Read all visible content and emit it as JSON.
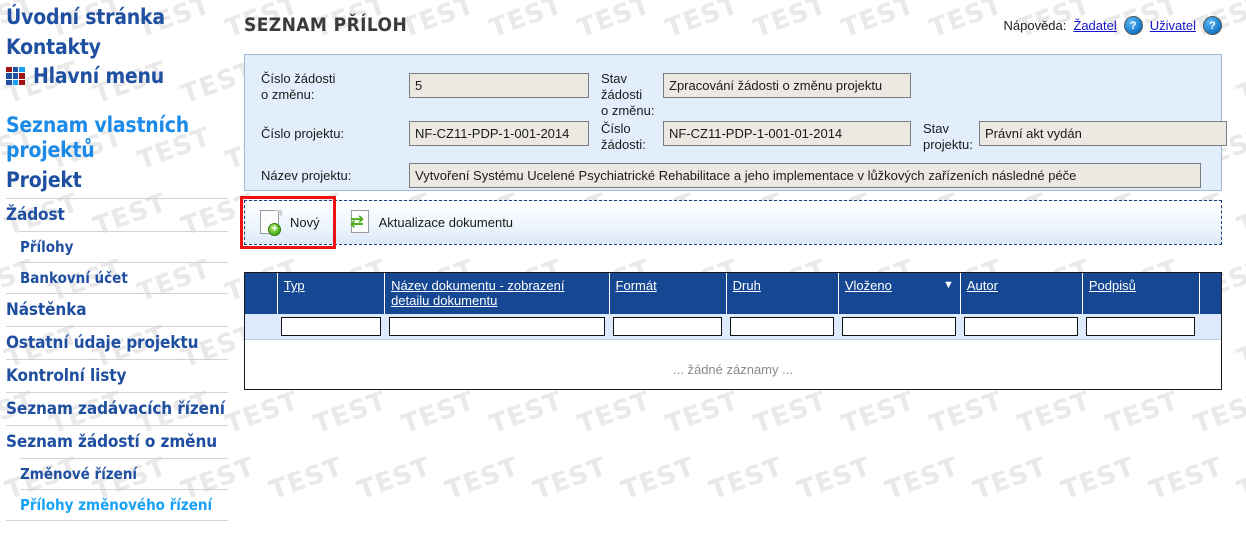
{
  "watermark": {
    "text": "TEST"
  },
  "sidebar": {
    "top_links": [
      {
        "label": "Úvodní stránka",
        "name": "sidebar-link-uvodni-stranka"
      },
      {
        "label": "Kontakty",
        "name": "sidebar-link-kontakty"
      }
    ],
    "main_menu_label": "Hlavní menu",
    "main_menu_icon": "grid-icon",
    "menu_icon_colors": [
      "#9e1316",
      "#1f4fa0",
      "#17a2f5",
      "#1f4fa0",
      "#1f4fa0",
      "#9e1316",
      "#1f4fa0",
      "#17a2f5",
      "#9e1316"
    ],
    "items": [
      {
        "label": "Seznam vlastních projektů",
        "level": 1,
        "active": true,
        "name": "sidebar-item-seznam-vlastnich-projektu"
      },
      {
        "label": "Projekt",
        "level": 1,
        "active": false,
        "name": "sidebar-item-projekt"
      },
      {
        "label": "Žádost",
        "level": 2,
        "active": false,
        "name": "sidebar-item-zadost"
      },
      {
        "label": "Přílohy",
        "level": 3,
        "active": false,
        "name": "sidebar-item-prilohy"
      },
      {
        "label": "Bankovní účet",
        "level": 3,
        "active": false,
        "name": "sidebar-item-bankovni-ucet"
      },
      {
        "label": "Nástěnka",
        "level": 2,
        "active": false,
        "name": "sidebar-item-nastenka"
      },
      {
        "label": "Ostatní údaje projektu",
        "level": 2,
        "active": false,
        "name": "sidebar-item-ostatni-udaje-projektu"
      },
      {
        "label": "Kontrolní listy",
        "level": 2,
        "active": false,
        "name": "sidebar-item-kontrolni-listy"
      },
      {
        "label": "Seznam zadávacích řízení",
        "level": 2,
        "active": false,
        "name": "sidebar-item-seznam-zadavacich-rizeni"
      },
      {
        "label": "Seznam žádostí o změnu",
        "level": 2,
        "active": false,
        "name": "sidebar-item-seznam-zadosti-o-zmenu"
      },
      {
        "label": "Změnové řízení",
        "level": 3,
        "active": false,
        "name": "sidebar-item-zmenove-rizeni"
      },
      {
        "label": "Přílohy změnového řízení",
        "level": 3,
        "active": true,
        "name": "sidebar-item-prilohy-zmenoveho-rizeni"
      }
    ]
  },
  "header": {
    "title": "SEZNAM PŘÍLOH",
    "help_label": "Nápověda:",
    "help_links": [
      {
        "label": "Žadatel",
        "name": "help-link-zadatel"
      },
      {
        "label": "Uživatel",
        "name": "help-link-uzivatel"
      }
    ],
    "help_icon": "question-mark-icon"
  },
  "form": {
    "fields": [
      {
        "label": "Číslo žádosti\no změnu:",
        "value": "5",
        "name": "field-cislo-zadosti-o-zmenu"
      },
      {
        "label": "Stav\nžádosti\no změnu:",
        "value": "Zpracování žádosti o změnu projektu",
        "name": "field-stav-zadosti-o-zmenu"
      },
      {
        "label": "Číslo projektu:",
        "value": "NF-CZ11-PDP-1-001-2014",
        "name": "field-cislo-projektu"
      },
      {
        "label": "Číslo\nžádosti:",
        "value": "NF-CZ11-PDP-1-001-01-2014",
        "name": "field-cislo-zadosti"
      },
      {
        "label": "Stav\nprojektu:",
        "value": "Právní akt vydán",
        "name": "field-stav-projektu"
      },
      {
        "label": "Název projektu:",
        "value": "Vytvoření Systému Ucelené Psychiatrické Rehabilitace a jeho implementace v lůžkových zařízeních následné péče",
        "name": "field-nazev-projektu"
      }
    ],
    "labels": {
      "cislo_zadosti_o_zmenu_l1": "Číslo žádosti",
      "cislo_zadosti_o_zmenu_l2": "o změnu:",
      "stav_zadosti_l1": "Stav",
      "stav_zadosti_l2": "žádosti",
      "stav_zadosti_l3": "o změnu:",
      "cislo_projektu": "Číslo projektu:",
      "cislo_zadosti_l1": "Číslo",
      "cislo_zadosti_l2": "žádosti:",
      "stav_projektu_l1": "Stav",
      "stav_projektu_l2": "projektu:",
      "nazev_projektu": "Název projektu:"
    },
    "values": {
      "cislo_zadosti_o_zmenu": "5",
      "stav_zadosti_o_zmenu": "Zpracování žádosti o změnu projektu",
      "cislo_projektu": "NF-CZ11-PDP-1-001-2014",
      "cislo_zadosti": "NF-CZ11-PDP-1-001-01-2014",
      "stav_projektu": "Právní akt vydán",
      "nazev_projektu": "Vytvoření Systému Ucelené Psychiatrické Rehabilitace a jeho implementace v lůžkových zařízeních následné péče"
    }
  },
  "toolbar": {
    "new_label": "Nový",
    "new_icon": "new-document-icon",
    "update_label": "Aktualizace dokumentu",
    "update_icon": "refresh-document-icon",
    "highlight_color": "#ee1111",
    "plus_glyph": "+",
    "refresh_glyph": "⇄"
  },
  "table": {
    "columns": [
      {
        "label": "",
        "name": "col-select",
        "width": "3.3%",
        "sorted": false
      },
      {
        "label": "Typ",
        "name": "col-typ",
        "width": "11.0%",
        "sorted": false
      },
      {
        "label": "Název dokumentu - zobrazení detailu dokumentu",
        "name": "col-nazev-dokumentu",
        "width": "23.0%",
        "sorted": false
      },
      {
        "label": "Formát",
        "name": "col-format",
        "width": "12.0%",
        "sorted": false
      },
      {
        "label": "Druh",
        "name": "col-druh",
        "width": "11.5%",
        "sorted": false
      },
      {
        "label": "Vloženo",
        "name": "col-vlozeno",
        "width": "12.5%",
        "sorted": true
      },
      {
        "label": "Autor",
        "name": "col-autor",
        "width": "12.5%",
        "sorted": false
      },
      {
        "label": "Podpisů",
        "name": "col-podpisu",
        "width": "12.0%",
        "sorted": false
      },
      {
        "label": "",
        "name": "col-actions",
        "width": "2.2%",
        "sorted": false
      }
    ],
    "sort_arrow": "▼",
    "filter_values": [
      "",
      "",
      "",
      "",
      "",
      "",
      ""
    ],
    "empty_message": "... žádné záznamy ..."
  },
  "colors": {
    "header_blue": "#154792",
    "panel_blue": "#e2eefb",
    "link_blue": "#1f4fa0",
    "active_blue": "#17a2f5",
    "field_bg": "#ece9e2"
  }
}
